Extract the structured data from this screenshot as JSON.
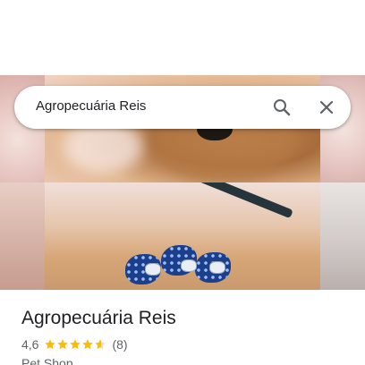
{
  "search": {
    "query": "Agropecuária Reis",
    "search_icon": "search-icon",
    "close_icon": "close-icon"
  },
  "photo": {
    "icon": "place-photo-collage"
  },
  "place": {
    "name": "Agropecuária Reis",
    "rating": "4,6",
    "rating_value": 4.6,
    "stars_max": 5,
    "review_count": "(8)",
    "category": "Pet Shop",
    "star_color": "#fbbc04",
    "star_empty_color": "#dadce0"
  }
}
